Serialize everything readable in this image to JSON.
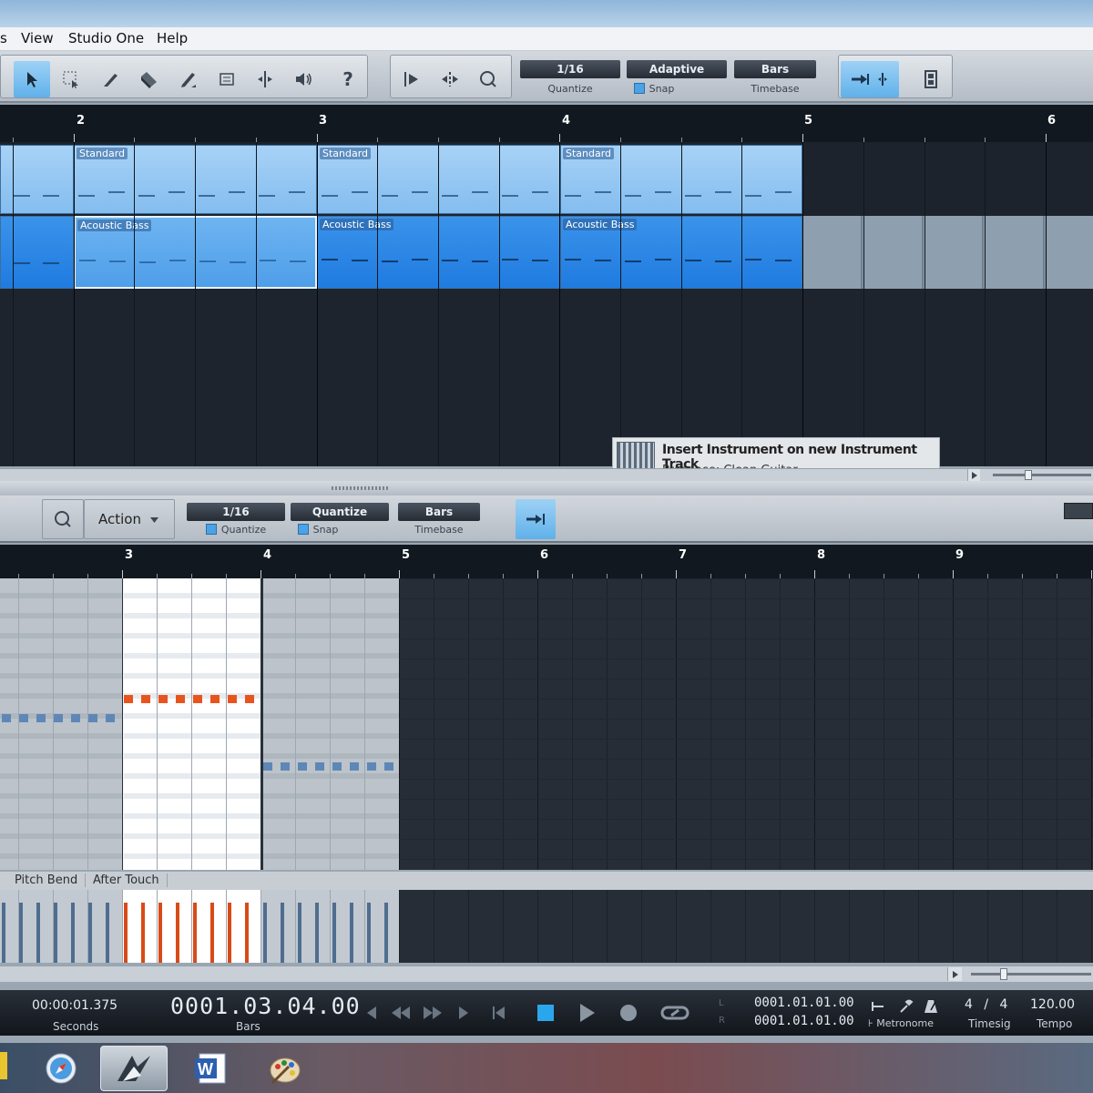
{
  "menu": {
    "partial": "s",
    "items": [
      "View",
      "Studio One",
      "Help"
    ]
  },
  "toolbar": {
    "tools": [
      "arrow-tool",
      "range-tool",
      "split-tool",
      "eraser-tool",
      "paint-tool",
      "mute-tool",
      "bend-tool",
      "listen-tool"
    ],
    "help_label": "?",
    "quantize": {
      "value": "1/16",
      "label": "Quantize"
    },
    "snap": {
      "value": "Adaptive",
      "label": "Snap"
    },
    "timebase": {
      "value": "Bars",
      "label": "Timebase"
    }
  },
  "arrange": {
    "ruler_bars": [
      "2",
      "3",
      "4",
      "5",
      "6"
    ],
    "tracks": [
      {
        "name": "Standard",
        "clips": [
          "Standard",
          "Standard",
          "Standard"
        ]
      },
      {
        "name": "Acoustic Bass",
        "clips": [
          "Acoustic Bass",
          "Acoustic Bass",
          "Acoustic Bass"
        ]
      }
    ]
  },
  "tooltip": {
    "title": "Insert Instrument on new Instrument Track",
    "subtitle": "Presence: Clean Guitar"
  },
  "editor": {
    "action_label": "Action",
    "quantize": {
      "value": "1/16",
      "label": "Quantize"
    },
    "snap": {
      "value": "Quantize",
      "label": "Snap"
    },
    "timebase": {
      "value": "Bars",
      "label": "Timebase"
    },
    "ruler_bars": [
      "3",
      "4",
      "5",
      "6",
      "7",
      "8",
      "9"
    ],
    "cc_tabs": [
      "Pitch Bend",
      "After Touch"
    ]
  },
  "transport": {
    "seconds": "00:00:01.375",
    "seconds_label": "Seconds",
    "bars": "0001.03.04.00",
    "bars_label": "Bars",
    "loop_l": "0001.01.01.00",
    "loop_r": "0001.01.01.00",
    "l_label": "L",
    "r_label": "R",
    "metronome_label": "Metronome",
    "timesig_num": "4",
    "timesig_sep": "/",
    "timesig_den": "4",
    "timesig_label": "Timesig",
    "tempo": "120.00",
    "tempo_label": "Tempo"
  },
  "colors": {
    "accent": "#4aa3e6",
    "note_selected": "#e8541d",
    "note": "#5e87b6"
  }
}
